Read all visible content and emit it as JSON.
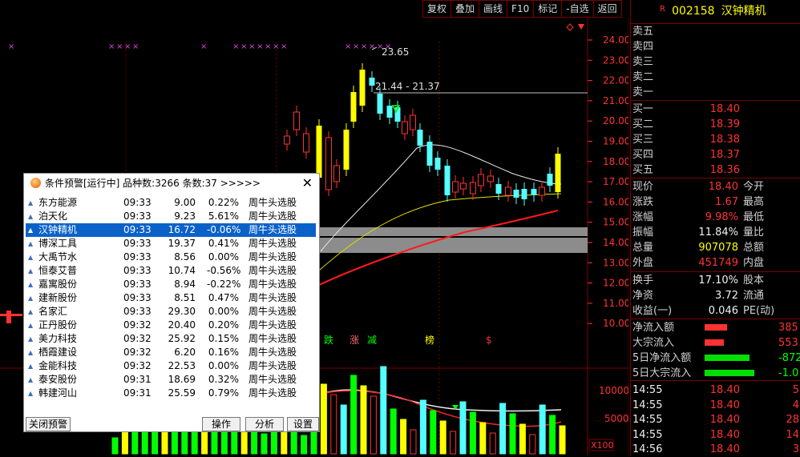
{
  "toolbar": {
    "items": [
      "复权",
      "叠加",
      "画线",
      "F10",
      "标记",
      "-自选",
      "返回"
    ]
  },
  "chart": {
    "axis_ticks": [
      "24.00",
      "23.00",
      "22.00",
      "21.00",
      "20.00",
      "19.00",
      "18.00",
      "17.00",
      "16.00",
      "15.00",
      "14.00",
      "13.00",
      "12.00",
      "11.00",
      "10.00"
    ],
    "high_label": "23.65",
    "range_label": "21.44 - 21.37",
    "markers": [
      "跌",
      "涨",
      "减",
      "榜",
      "$"
    ],
    "vol_ticks": [
      "10000",
      "5000"
    ],
    "vol_unit": "X100"
  },
  "colors": {
    "up": "#ff3232",
    "down": "#54ffff",
    "border": "#7a0000",
    "yellow": "#ffff00",
    "green": "#00ff00",
    "select": "#0a62c9"
  },
  "stock": {
    "badge": "R",
    "code": "002158",
    "name": "汉钟精机"
  },
  "orderbook": {
    "sell": [
      "卖五",
      "卖四",
      "卖三",
      "卖二",
      "卖一"
    ],
    "buy": [
      {
        "label": "买一",
        "price": "18.40"
      },
      {
        "label": "买二",
        "price": "18.39"
      },
      {
        "label": "买三",
        "price": "18.38"
      },
      {
        "label": "买四",
        "price": "18.37"
      },
      {
        "label": "买五",
        "price": "18.36"
      }
    ]
  },
  "quote": [
    {
      "l1": "现价",
      "v1": "18.40",
      "c1": "red",
      "l2": "今开"
    },
    {
      "l1": "涨跌",
      "v1": "1.67",
      "c1": "red",
      "l2": "最高"
    },
    {
      "l1": "涨幅",
      "v1": "9.98%",
      "c1": "red",
      "l2": "最低"
    },
    {
      "l1": "振幅",
      "v1": "11.84%",
      "c1": "wht",
      "l2": "量比"
    },
    {
      "l1": "总量",
      "v1": "907078",
      "c1": "yel",
      "l2": "总额"
    },
    {
      "l1": "外盘",
      "v1": "451749",
      "c1": "red",
      "l2": "内盘"
    }
  ],
  "finance": [
    {
      "l1": "换手",
      "v1": "17.10%",
      "l2": "股本"
    },
    {
      "l1": "净资",
      "v1": "3.72",
      "l2": "流通"
    },
    {
      "l1": "收益(一)",
      "v1": "0.046",
      "l2": "PE(动)"
    }
  ],
  "flows": [
    {
      "label": "净流入额",
      "val": "385",
      "color": "red",
      "bar": 0.35
    },
    {
      "label": "大宗流入",
      "val": "553",
      "color": "red",
      "bar": 0.3
    },
    {
      "label": "5日净流入额",
      "val": "-872",
      "color": "grn",
      "bar": 0.7
    },
    {
      "label": "5日大宗流入",
      "val": "-1.0",
      "color": "grn",
      "bar": 0.78
    }
  ],
  "ticks": [
    {
      "time": "14:55",
      "price": "18.40",
      "vol": "5"
    },
    {
      "time": "14:55",
      "price": "18.40",
      "vol": "4"
    },
    {
      "time": "14:55",
      "price": "18.40",
      "vol": "28"
    },
    {
      "time": "14:55",
      "price": "18.40",
      "vol": "14"
    },
    {
      "time": "14:56",
      "price": "18.40",
      "vol": "3"
    }
  ],
  "dialog": {
    "title": "条件预警[运行中] 品种数:3266 条数:37  >>>>>",
    "close": "✕",
    "rows": [
      {
        "name": "东方能源",
        "time": "09:33",
        "price": "9.00",
        "chg": "0.22%",
        "cond": "周牛头选股"
      },
      {
        "name": "泊天化",
        "time": "09:33",
        "price": "9.23",
        "chg": "5.61%",
        "cond": "周牛头选股"
      },
      {
        "name": "汉钟精机",
        "time": "09:33",
        "price": "16.72",
        "chg": "-0.06%",
        "cond": "周牛头选股"
      },
      {
        "name": "博深工具",
        "time": "09:33",
        "price": "19.37",
        "chg": "0.41%",
        "cond": "周牛头选股"
      },
      {
        "name": "大禹节水",
        "time": "09:33",
        "price": "8.56",
        "chg": "0.00%",
        "cond": "周牛头选股"
      },
      {
        "name": "恒泰艾普",
        "time": "09:33",
        "price": "10.74",
        "chg": "-0.56%",
        "cond": "周牛头选股"
      },
      {
        "name": "嘉寓股份",
        "time": "09:33",
        "price": "8.94",
        "chg": "-0.22%",
        "cond": "周牛头选股"
      },
      {
        "name": "建新股份",
        "time": "09:33",
        "price": "8.51",
        "chg": "0.47%",
        "cond": "周牛头选股"
      },
      {
        "name": "名家汇",
        "time": "09:33",
        "price": "29.30",
        "chg": "0.00%",
        "cond": "周牛头选股"
      },
      {
        "name": "正丹股份",
        "time": "09:32",
        "price": "20.40",
        "chg": "0.20%",
        "cond": "周牛头选股"
      },
      {
        "name": "美力科技",
        "time": "09:32",
        "price": "25.92",
        "chg": "0.15%",
        "cond": "周牛头选股"
      },
      {
        "name": "栖霞建设",
        "time": "09:32",
        "price": "6.20",
        "chg": "0.16%",
        "cond": "周牛头选股"
      },
      {
        "name": "金能科技",
        "time": "09:32",
        "price": "22.53",
        "chg": "0.00%",
        "cond": "周牛头选股"
      },
      {
        "name": "泰安股份",
        "time": "09:31",
        "price": "18.69",
        "chg": "0.32%",
        "cond": "周牛头选股"
      },
      {
        "name": "韩建河山",
        "time": "09:31",
        "price": "25.59",
        "chg": "0.79%",
        "cond": "周牛头选股"
      }
    ],
    "selected_index": 2,
    "buttons": {
      "close_alert": "关闭预警",
      "operate": "操作",
      "analyze": "分析",
      "settings": "设置"
    }
  }
}
